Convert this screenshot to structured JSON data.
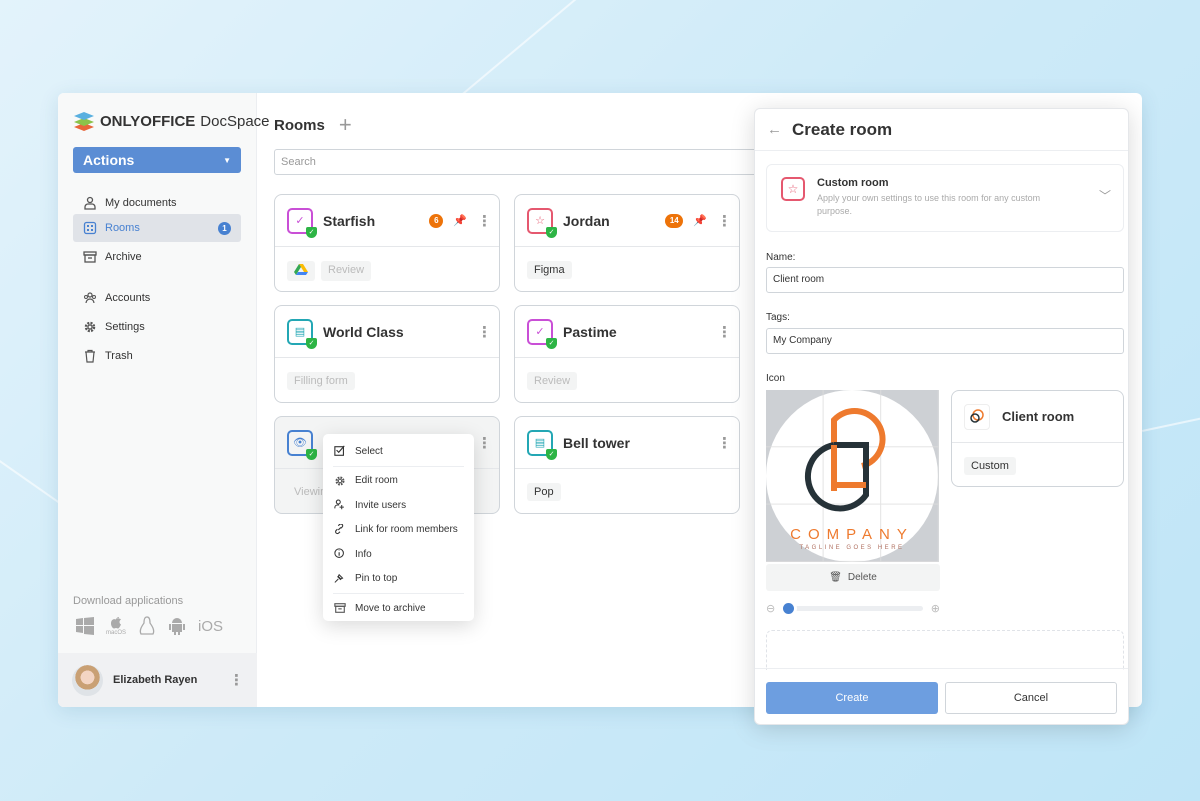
{
  "brand": {
    "name_bold": "ONLYOFFICE",
    "name_rest": "DocSpace"
  },
  "sidebar": {
    "actions_label": "Actions",
    "items": [
      {
        "label": "My documents",
        "icon": "user-icon"
      },
      {
        "label": "Rooms",
        "icon": "rooms-grid-icon",
        "badge": "1",
        "active": true
      },
      {
        "label": "Archive",
        "icon": "archive-icon"
      },
      {
        "label": "Accounts",
        "icon": "accounts-icon"
      },
      {
        "label": "Settings",
        "icon": "gear-icon"
      },
      {
        "label": "Trash",
        "icon": "trash-icon"
      }
    ],
    "download_label": "Download applications",
    "apps": {
      "macos": "macOS",
      "ios": "iOS"
    },
    "user_name": "Elizabeth Rayen"
  },
  "main": {
    "title": "Rooms",
    "search_placeholder": "Search",
    "cards": [
      {
        "name": "Starfish",
        "icon_color": "#c94fd6",
        "badge": "6",
        "pinned": true,
        "tags": [
          "Review"
        ],
        "gdrive": true,
        "dim": true
      },
      {
        "name": "Jordan",
        "icon_color": "#e5586f",
        "badge": "14",
        "pinned": true,
        "tags": [
          "Figma"
        ]
      },
      {
        "name": "World Class",
        "icon_color": "#23a7b4",
        "tags": [
          "Filling form"
        ],
        "dim": true
      },
      {
        "name": "Pastime",
        "icon_color": "#c94fd6",
        "tags": [
          "Review"
        ],
        "dim": true
      },
      {
        "name": "",
        "icon_color": "#4781d1",
        "tags": [
          "Viewing"
        ],
        "dim": true,
        "hover": true
      },
      {
        "name": "Bell tower",
        "icon_color": "#23a7b4",
        "tags": [
          "Pop"
        ]
      }
    ]
  },
  "context_menu": {
    "items": [
      {
        "label": "Select",
        "icon": "checkbox-icon"
      },
      {
        "label": "Edit room",
        "icon": "gear-icon"
      },
      {
        "label": "Invite users",
        "icon": "invite-user-icon"
      },
      {
        "label": "Link for room members",
        "icon": "link-icon"
      },
      {
        "label": "Info",
        "icon": "info-icon"
      },
      {
        "label": "Pin to top",
        "icon": "pin-icon"
      },
      {
        "label": "Move to archive",
        "icon": "archive-icon"
      }
    ]
  },
  "create_room": {
    "title": "Create room",
    "room_type": {
      "title": "Custom room",
      "description": "Apply your own settings to use this room for any custom purpose."
    },
    "name_label": "Name:",
    "name_value": "Client room",
    "tags_label": "Tags:",
    "tags_value": "My Company",
    "icon_label": "Icon",
    "logo_text": "COMPANY",
    "logo_tagline": "TAGLINE GOES HERE",
    "delete_label": "Delete",
    "zoom_level": 0.0,
    "preview": {
      "name": "Client room",
      "tag": "Custom"
    },
    "create_label": "Create",
    "cancel_label": "Cancel"
  },
  "colors": {
    "accent": "#4781d1",
    "button": "#6d9ee0",
    "badge": "#ed7309",
    "logo_orange": "#ee7a2e",
    "logo_dark": "#263238"
  }
}
